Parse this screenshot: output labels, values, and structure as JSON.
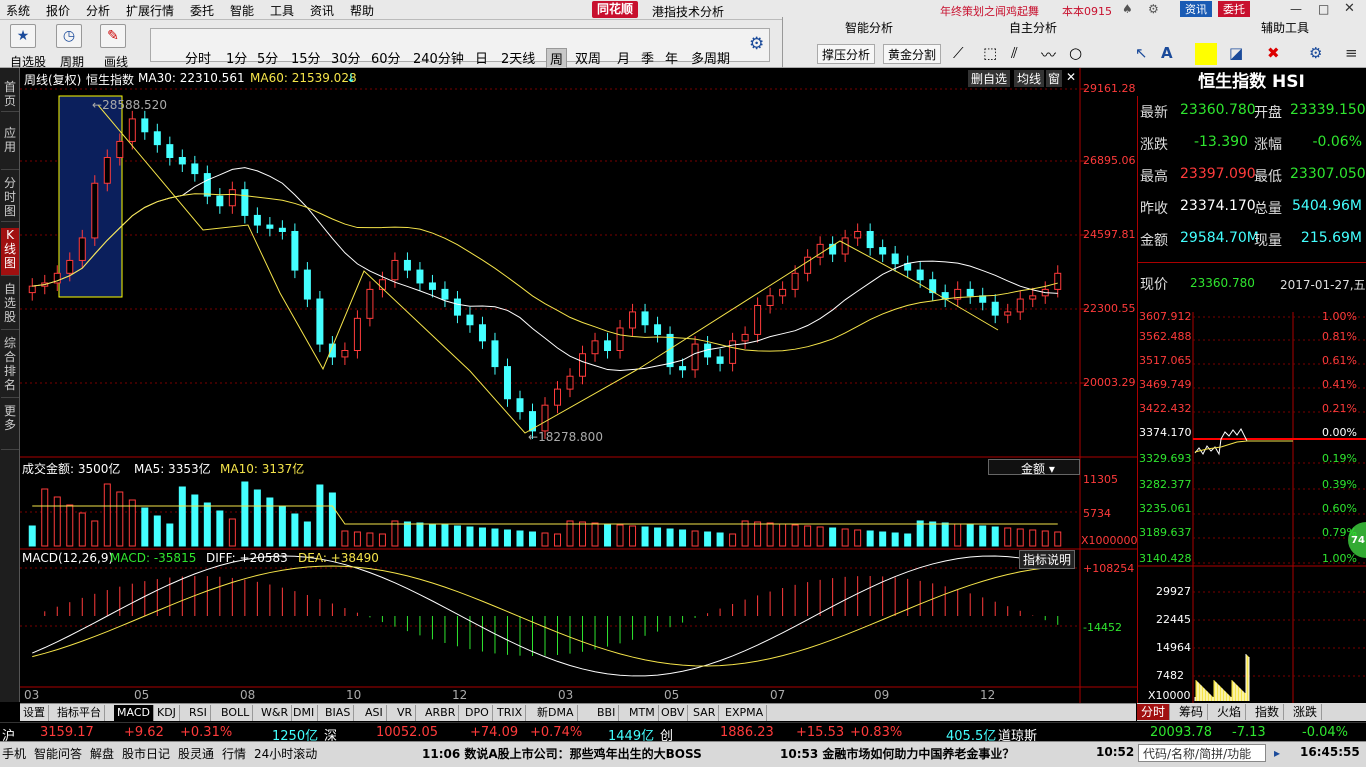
{
  "menubar": {
    "items": [
      "系统",
      "报价",
      "分析",
      "扩展行情",
      "委托",
      "智能",
      "工具",
      "资讯",
      "帮助"
    ],
    "brand": "同花顺",
    "window_title": "港指技术分析",
    "promo": "年终策划之闻鸡起舞",
    "user": "本本0915",
    "btn_info": "资讯",
    "btn_trade": "委托"
  },
  "toolbar": {
    "labels": [
      "自选股",
      "周期",
      "画线"
    ],
    "periods": [
      "分时",
      "1分",
      "5分",
      "15分",
      "30分",
      "60分",
      "240分钟",
      "日",
      "2天线",
      "周",
      "双周",
      "月",
      "季",
      "年",
      "多周期"
    ],
    "selected_period": "周"
  },
  "right_toolbar": {
    "group1": "智能分析",
    "group2": "自主分析",
    "group3": "辅助工具",
    "btn1": "撑压分析",
    "btn2": "黄金分割"
  },
  "left_tabs": [
    "首页",
    "应用",
    "分时图",
    "K线图",
    "自选股",
    "综合排名",
    "更多"
  ],
  "main_chart": {
    "header": {
      "left": "周线(复权)",
      "name": "恒生指数",
      "ma30": "MA30: 22310.561",
      "ma60": "MA60: 21539.028"
    },
    "corner_btns": [
      "删自选",
      "均线",
      "窗"
    ],
    "high_label": "28588.520",
    "low_label": "18278.800",
    "price_ticks": [
      "29161.28",
      "26895.06",
      "24597.81",
      "22300.55",
      "20003.29"
    ]
  },
  "volume": {
    "header": {
      "label": "成交金额: 3500亿",
      "ma5": "MA5: 3353亿",
      "ma10": "MA10: 3137亿"
    },
    "dropdown": "金额",
    "ticks": [
      "11305",
      "5734",
      "X1000000"
    ]
  },
  "macd": {
    "header": {
      "label": "MACD(12,26,9)",
      "macd": "MACD: -35815",
      "diff": "DIFF: +20583",
      "dea": "DEA: +38490"
    },
    "btn": "指标说明",
    "ticks": [
      "+108254",
      "-14452"
    ]
  },
  "x_axis": [
    "03",
    "05",
    "08",
    "10",
    "12",
    "03",
    "05",
    "07",
    "09",
    "12"
  ],
  "bottom_tabs": [
    "设置",
    "指标平台",
    "MACD",
    "KDJ",
    "RSI",
    "BOLL",
    "W&R",
    "DMI",
    "BIAS",
    "ASI",
    "VR",
    "ARBR",
    "DPO",
    "TRIX",
    "新DMA",
    "BBI",
    "MTM",
    "OBV",
    "SAR",
    "EXPMA"
  ],
  "quote": {
    "title": "恒生指数 HSI",
    "rows": [
      {
        "l1": "最新",
        "v1": "23360.780",
        "l2": "开盘",
        "v2": "23339.150"
      },
      {
        "l1": "涨跌",
        "v1": "-13.390",
        "l2": "涨幅",
        "v2": "-0.06%"
      },
      {
        "l1": "最高",
        "v1": "23397.090",
        "l2": "最低",
        "v2": "23307.050"
      },
      {
        "l1": "昨收",
        "v1": "23374.170",
        "l2": "总量",
        "v2": "5404.96M"
      },
      {
        "l1": "金额",
        "v1": "29584.70M",
        "l2": "现量",
        "v2": "215.69M"
      }
    ],
    "now_label": "现价",
    "now_value": "23360.780",
    "date": "2017-01-27,五"
  },
  "mini_chart": {
    "left_ticks": [
      "3607.912",
      "3562.488",
      "3517.065",
      "3469.749",
      "3422.432",
      "3374.170",
      "3329.693",
      "3282.377",
      "3235.061",
      "3189.637",
      "3140.428"
    ],
    "right_ticks": [
      "1.00%",
      "0.81%",
      "0.61%",
      "0.41%",
      "0.21%",
      "0.00%",
      "0.19%",
      "0.39%",
      "0.60%",
      "0.79%",
      "1.00%"
    ],
    "vol_ticks": [
      "29927",
      "22445",
      "14964",
      "7482",
      "X10000"
    ],
    "badge": "74"
  },
  "right_bottom_tabs": [
    "分时",
    "筹码",
    "火焰",
    "指数",
    "涨跌"
  ],
  "status1": {
    "sh_label": "沪",
    "sh_val": "3159.17",
    "sh_chg": "+9.62",
    "sh_pct": "+0.31%",
    "sh_amt": "1250亿",
    "sz_label": "深",
    "sz_val": "10052.05",
    "sz_chg": "+74.09",
    "sz_pct": "+0.74%",
    "cy_amt": "1449亿",
    "cy_label": "创",
    "cy_val": "1886.23",
    "cy_chg": "+15.53",
    "cy_pct": "+0.83%",
    "dj_amt": "405.5亿",
    "dj_label": "道琼斯",
    "dj_val": "20093.78",
    "dj_chg": "-7.13",
    "dj_pct": "-0.04%"
  },
  "status2": {
    "items": [
      "手机",
      "智能问答",
      "解盘",
      "股市日记",
      "股灵通",
      "行情",
      "24小时滚动"
    ],
    "news1": "11:06 数说A股上市公司：那些鸡年出生的大BOSS",
    "news2": "10:53 金融市场如何助力中国养老金事业？",
    "time1": "10:52",
    "search": "代码/名称/简拼/功能",
    "clock": "16:45:55"
  }
}
